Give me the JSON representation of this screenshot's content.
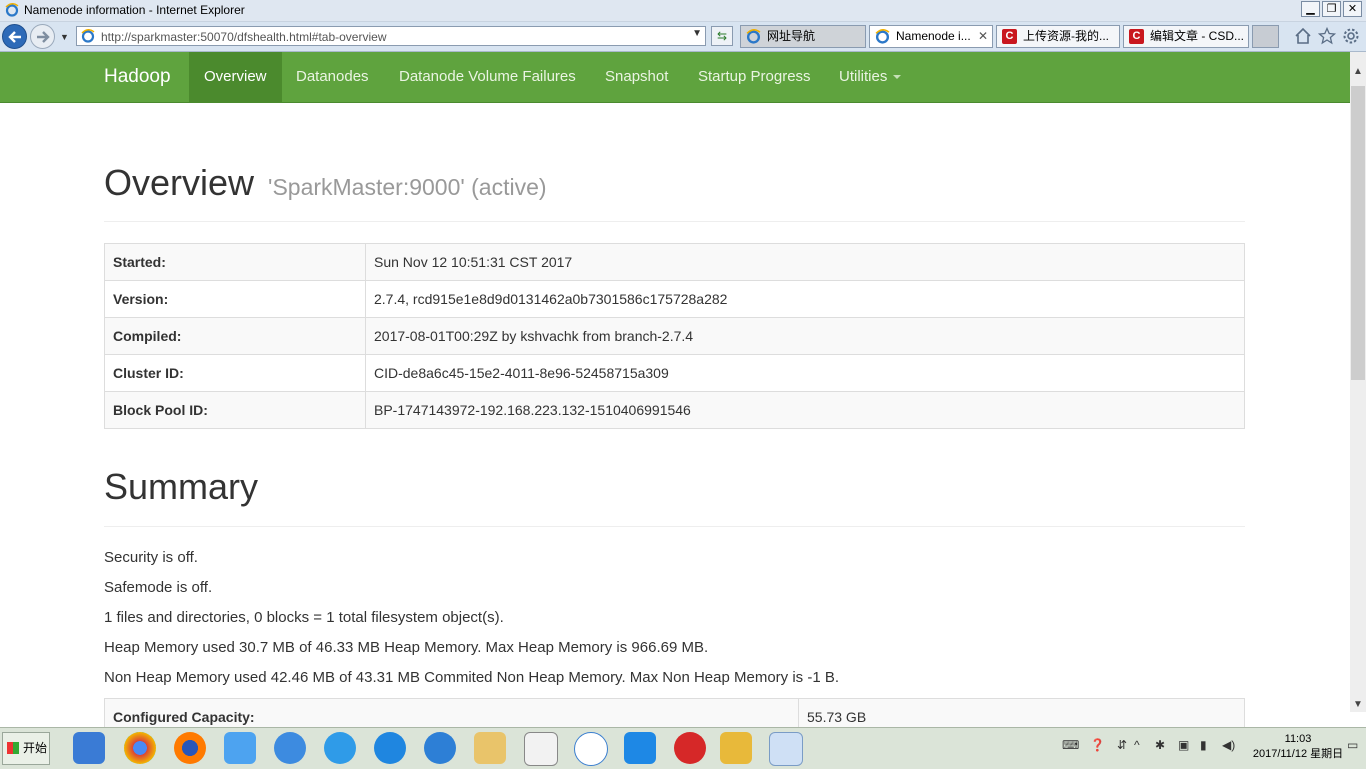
{
  "window": {
    "title": "Namenode information - Internet Explorer"
  },
  "browser": {
    "url": "http://sparkmaster:50070/dfshealth.html#tab-overview",
    "tabs": [
      {
        "label": "网址导航"
      },
      {
        "label": "Namenode i..."
      },
      {
        "label": "上传资源-我的..."
      },
      {
        "label": "编辑文章 - CSD..."
      }
    ]
  },
  "navbar": {
    "brand": "Hadoop",
    "items": [
      "Overview",
      "Datanodes",
      "Datanode Volume Failures",
      "Snapshot",
      "Startup Progress",
      "Utilities"
    ]
  },
  "overview": {
    "title": "Overview",
    "subtitle": "'SparkMaster:9000' (active)",
    "rows": [
      {
        "k": "Started:",
        "v": "Sun Nov 12 10:51:31 CST 2017"
      },
      {
        "k": "Version:",
        "v": "2.7.4, rcd915e1e8d9d0131462a0b7301586c175728a282"
      },
      {
        "k": "Compiled:",
        "v": "2017-08-01T00:29Z by kshvachk from branch-2.7.4"
      },
      {
        "k": "Cluster ID:",
        "v": "CID-de8a6c45-15e2-4011-8e96-52458715a309"
      },
      {
        "k": "Block Pool ID:",
        "v": "BP-1747143972-192.168.223.132-1510406991546"
      }
    ]
  },
  "summary": {
    "title": "Summary",
    "lines": [
      "Security is off.",
      "Safemode is off.",
      "1 files and directories, 0 blocks = 1 total filesystem object(s).",
      "Heap Memory used 30.7 MB of 46.33 MB Heap Memory. Max Heap Memory is 966.69 MB.",
      "Non Heap Memory used 42.46 MB of 43.31 MB Commited Non Heap Memory. Max Non Heap Memory is -1 B."
    ],
    "table": [
      {
        "k": "Configured Capacity:",
        "v": "55.73 GB"
      }
    ]
  },
  "taskbar": {
    "start": "开始",
    "clock_time": "11:03",
    "clock_date": "2017/11/12 星期日"
  }
}
